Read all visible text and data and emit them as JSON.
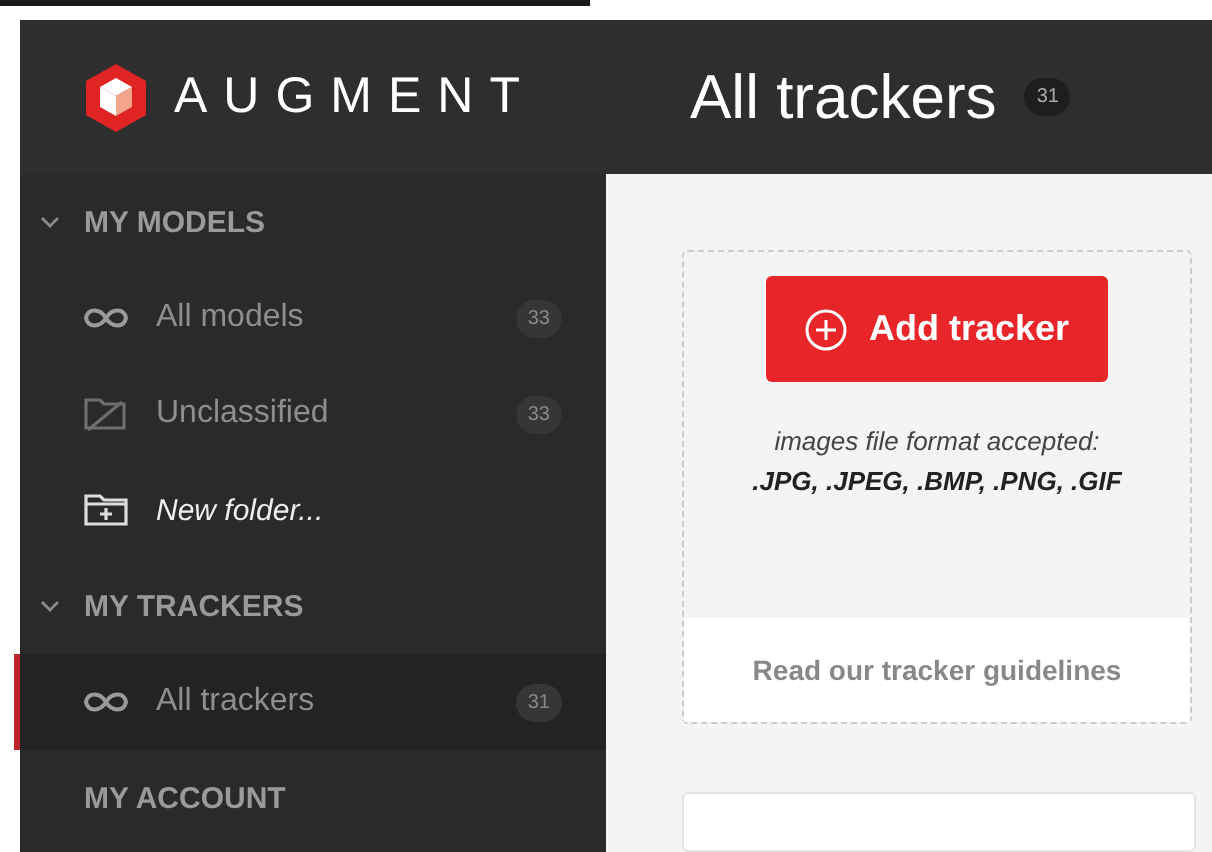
{
  "header": {
    "brand": "AUGMENT",
    "title": "All trackers",
    "count": "31"
  },
  "sidebar": {
    "sections": [
      {
        "title": "MY MODELS",
        "kind": "group",
        "expanded": true,
        "items": [
          {
            "label": "All models",
            "kind": "all",
            "count": "33",
            "selected": false
          },
          {
            "label": "Unclassified",
            "kind": "unclassified",
            "count": "33",
            "selected": false
          },
          {
            "label": "New folder...",
            "kind": "new-folder",
            "selected": false
          }
        ]
      },
      {
        "title": "MY TRACKERS",
        "kind": "group",
        "expanded": true,
        "items": [
          {
            "label": "All trackers",
            "kind": "all",
            "count": "31",
            "selected": true
          }
        ]
      },
      {
        "title": "MY ACCOUNT",
        "kind": "link"
      }
    ]
  },
  "upload_card": {
    "button": "Add tracker",
    "hint": "images file format accepted:",
    "formats": ".JPG, .JPEG, .BMP, .PNG, .GIF",
    "footer_link": "Read our tracker guidelines"
  }
}
